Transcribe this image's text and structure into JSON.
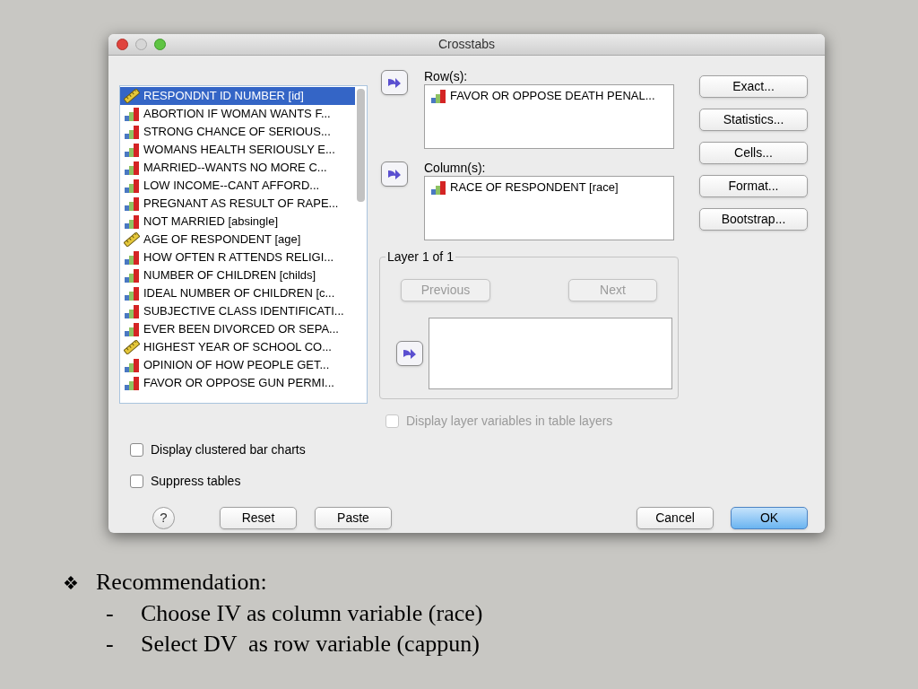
{
  "window": {
    "title": "Crosstabs"
  },
  "variables": [
    {
      "label": "RESPONDNT ID NUMBER [id]",
      "kind": "scale",
      "selected": true
    },
    {
      "label": "ABORTION IF WOMAN WANTS F...",
      "kind": "nominal",
      "selected": false
    },
    {
      "label": "STRONG CHANCE OF SERIOUS...",
      "kind": "nominal",
      "selected": false
    },
    {
      "label": "WOMANS HEALTH SERIOUSLY E...",
      "kind": "nominal",
      "selected": false
    },
    {
      "label": "MARRIED--WANTS NO MORE C...",
      "kind": "nominal",
      "selected": false
    },
    {
      "label": "LOW INCOME--CANT AFFORD...",
      "kind": "nominal",
      "selected": false
    },
    {
      "label": "PREGNANT AS RESULT OF RAPE...",
      "kind": "nominal",
      "selected": false
    },
    {
      "label": "NOT MARRIED [absingle]",
      "kind": "nominal",
      "selected": false
    },
    {
      "label": "AGE OF RESPONDENT [age]",
      "kind": "scale",
      "selected": false
    },
    {
      "label": "HOW OFTEN R ATTENDS RELIGI...",
      "kind": "nominal",
      "selected": false
    },
    {
      "label": "NUMBER OF CHILDREN [childs]",
      "kind": "nominal",
      "selected": false
    },
    {
      "label": "IDEAL NUMBER OF CHILDREN [c...",
      "kind": "nominal",
      "selected": false
    },
    {
      "label": "SUBJECTIVE CLASS IDENTIFICATI...",
      "kind": "nominal",
      "selected": false
    },
    {
      "label": "EVER BEEN DIVORCED OR SEPA...",
      "kind": "nominal",
      "selected": false
    },
    {
      "label": "HIGHEST YEAR OF SCHOOL CO...",
      "kind": "scale",
      "selected": false
    },
    {
      "label": "OPINION OF HOW PEOPLE GET...",
      "kind": "nominal",
      "selected": false
    },
    {
      "label": "FAVOR OR OPPOSE GUN PERMI...",
      "kind": "nominal",
      "selected": false
    }
  ],
  "rows": {
    "label": "Row(s):",
    "items": [
      {
        "label": "FAVOR OR OPPOSE DEATH PENAL...",
        "kind": "nominal"
      }
    ]
  },
  "columns": {
    "label": "Column(s):",
    "items": [
      {
        "label": "RACE OF RESPONDENT [race]",
        "kind": "nominal"
      }
    ]
  },
  "side_buttons": [
    "Exact...",
    "Statistics...",
    "Cells...",
    "Format...",
    "Bootstrap..."
  ],
  "layer": {
    "title": "Layer 1 of 1",
    "previous": {
      "label": "Previous",
      "disabled": true
    },
    "next": {
      "label": "Next",
      "disabled": true
    }
  },
  "layer_option": {
    "label": "Display layer variables in table layers",
    "checked": false,
    "disabled": true
  },
  "options": [
    {
      "label": "Display clustered bar charts",
      "checked": false
    },
    {
      "label": "Suppress tables",
      "checked": false
    }
  ],
  "help": "?",
  "footer_left": [
    {
      "label": "Reset",
      "default": false
    },
    {
      "label": "Paste",
      "default": false
    }
  ],
  "footer_right": [
    {
      "label": "Cancel",
      "default": false
    },
    {
      "label": "OK",
      "default": true
    }
  ],
  "slide": {
    "marker": "❖",
    "heading": "Recommendation:",
    "bullets": [
      {
        "marker": "-",
        "text": "Choose IV as column variable (race)"
      },
      {
        "marker": "-",
        "text": "Select DV  as row variable (cappun)"
      }
    ]
  }
}
